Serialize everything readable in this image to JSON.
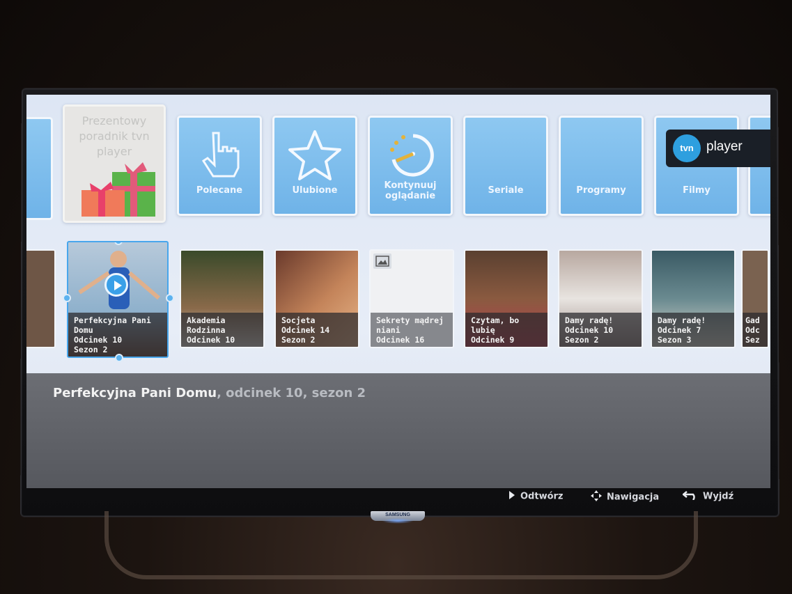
{
  "promo": {
    "text": "Prezentowy poradnik tvn player"
  },
  "categories": [
    {
      "label": "Polecane",
      "icon": "hand-pointer-icon"
    },
    {
      "label": "Ulubione",
      "icon": "star-icon"
    },
    {
      "label": "Kontynuuj oglądanie",
      "icon": "resume-clock-icon"
    },
    {
      "label": "Seriale",
      "icon": ""
    },
    {
      "label": "Programy",
      "icon": ""
    },
    {
      "label": "Filmy",
      "icon": ""
    }
  ],
  "brand": {
    "logo": "tvn",
    "product": "player",
    "tv_maker": "SAMSUNG"
  },
  "thumbnails": [
    {
      "caption": "Perfekcyjna Pani\nDomu\nOdcinek 10\nSezon 2",
      "selected": true,
      "color": "#7fa3c2"
    },
    {
      "caption": "Akademia\nRodzinna\nOdcinek 10",
      "color": "#4c5c3a"
    },
    {
      "caption": "Socjeta\nOdcinek 14\nSezon 2",
      "color": "#8c5a44"
    },
    {
      "caption": "Sekrety mądrej\nniani\nOdcinek 16",
      "placeholder": true,
      "color": "#eef0f3"
    },
    {
      "caption": "Czytam, bo\nlubię\nOdcinek 9",
      "color": "#6a4a34"
    },
    {
      "caption": "Damy radę!\nOdcinek 10\nSezon 2",
      "color": "#9a8c86"
    },
    {
      "caption": "Damy radę!\nOdcinek 7\nSezon 3",
      "color": "#5a6a6c"
    },
    {
      "caption": "Gad\nOdc\nSez",
      "color": "#7a6250"
    }
  ],
  "info": {
    "title": "Perfekcyjna Pani Domu",
    "subtitle": ", odcinek 10, sezon 2"
  },
  "hints": {
    "open": "Odtwórz",
    "navigate": "Nawigacja",
    "exit": "Wyjdź"
  },
  "colors": {
    "tile": "#7cbbec",
    "selection": "#48a6ec",
    "tvn_blue": "#2e9fdf"
  }
}
